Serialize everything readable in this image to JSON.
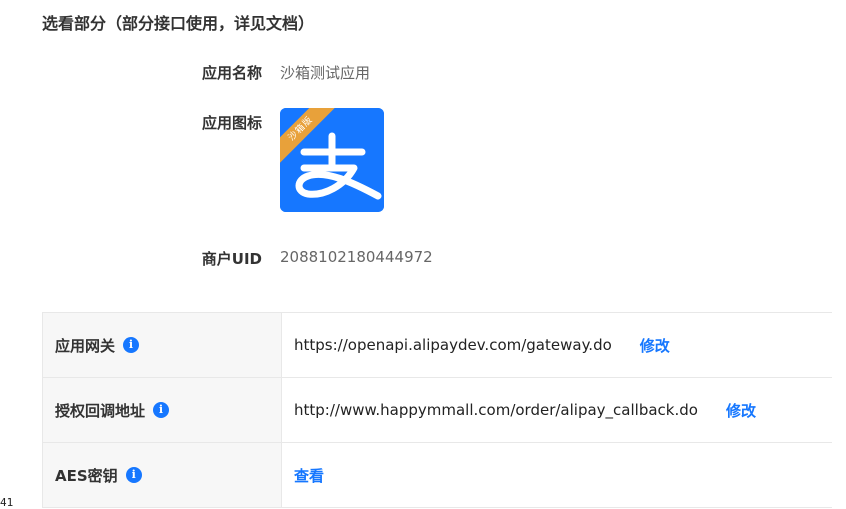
{
  "section": {
    "title": "选看部分（部分接口使用，详见文档）"
  },
  "app": {
    "name_label": "应用名称",
    "name_value": "沙箱测试应用",
    "icon_label": "应用图标",
    "icon_badge": "沙箱版",
    "icon_glyph": "支",
    "uid_label": "商户UID",
    "uid_value": "2088102180444972"
  },
  "table": {
    "rows": [
      {
        "label": "应用网关",
        "value": "https://openapi.alipaydev.com/gateway.do",
        "action": "修改"
      },
      {
        "label": "授权回调地址",
        "value": "http://www.happymmall.com/order/alipay_callback.do",
        "action": "修改"
      },
      {
        "label": "AES密钥",
        "value": "",
        "action": "查看"
      }
    ]
  },
  "corner_number": "41",
  "colors": {
    "accent": "#1677ff",
    "badge": "#e8a13a",
    "label_bg": "#f7f7f7"
  },
  "icons": {
    "info": "info-circle-icon",
    "app": "alipay-logo-icon"
  }
}
